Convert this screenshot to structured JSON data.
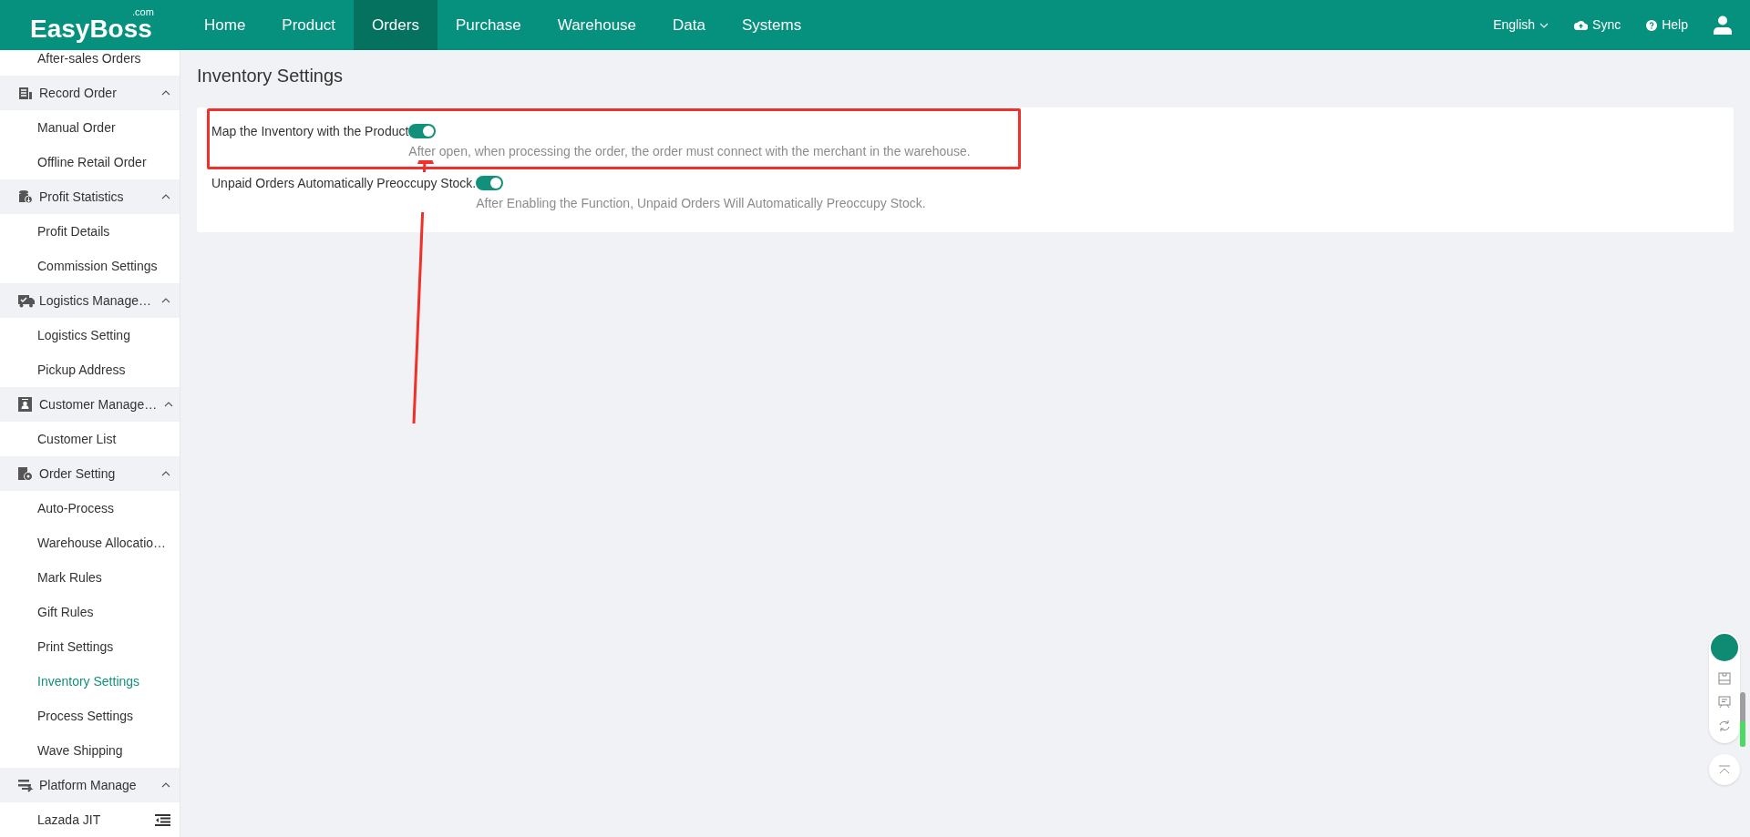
{
  "topbar": {
    "logo": "EasyBoss",
    "logo_suffix": ".com",
    "nav": [
      {
        "label": "Home",
        "selected": false
      },
      {
        "label": "Product",
        "selected": false
      },
      {
        "label": "Orders",
        "selected": true
      },
      {
        "label": "Purchase",
        "selected": false
      },
      {
        "label": "Warehouse",
        "selected": false
      },
      {
        "label": "Data",
        "selected": false
      },
      {
        "label": "Systems",
        "selected": false
      }
    ],
    "language": "English",
    "sync": "Sync",
    "help": "Help"
  },
  "sidebar": {
    "items": [
      {
        "kind": "item",
        "label": "After-sales Orders",
        "selected": false
      },
      {
        "kind": "group",
        "label": "Record Order",
        "expanded": true,
        "children": [
          {
            "label": "Manual Order",
            "selected": false
          },
          {
            "label": "Offline Retail Order",
            "selected": false
          }
        ]
      },
      {
        "kind": "group",
        "label": "Profit Statistics",
        "expanded": true,
        "children": [
          {
            "label": "Profit Details",
            "selected": false
          },
          {
            "label": "Commission Settings",
            "selected": false
          }
        ]
      },
      {
        "kind": "group",
        "label": "Logistics Manage…",
        "expanded": true,
        "children": [
          {
            "label": "Logistics Setting",
            "selected": false
          },
          {
            "label": "Pickup Address",
            "selected": false
          }
        ]
      },
      {
        "kind": "group",
        "label": "Customer Manage…",
        "expanded": true,
        "children": [
          {
            "label": "Customer List",
            "selected": false
          }
        ]
      },
      {
        "kind": "group",
        "label": "Order Setting",
        "expanded": true,
        "children": [
          {
            "label": "Auto-Process",
            "selected": false
          },
          {
            "label": "Warehouse Allocatio…",
            "selected": false
          },
          {
            "label": "Mark Rules",
            "selected": false
          },
          {
            "label": "Gift Rules",
            "selected": false
          },
          {
            "label": "Print Settings",
            "selected": false
          },
          {
            "label": "Inventory Settings",
            "selected": true
          },
          {
            "label": "Process Settings",
            "selected": false
          },
          {
            "label": "Wave Shipping",
            "selected": false
          }
        ]
      },
      {
        "kind": "group",
        "label": "Platform Manage",
        "expanded": true,
        "children": [
          {
            "label": "Lazada JIT",
            "selected": false
          }
        ]
      }
    ]
  },
  "page": {
    "title": "Inventory Settings",
    "settings": [
      {
        "label": "Map the Inventory with the Product",
        "on": true,
        "description": "After open, when processing the order, the order must connect with the merchant in the warehouse."
      },
      {
        "label": "Unpaid Orders Automatically Preoccupy Stock.",
        "on": true,
        "description": "After Enabling the Function, Unpaid Orders Will Automatically Preoccupy Stock."
      }
    ]
  }
}
